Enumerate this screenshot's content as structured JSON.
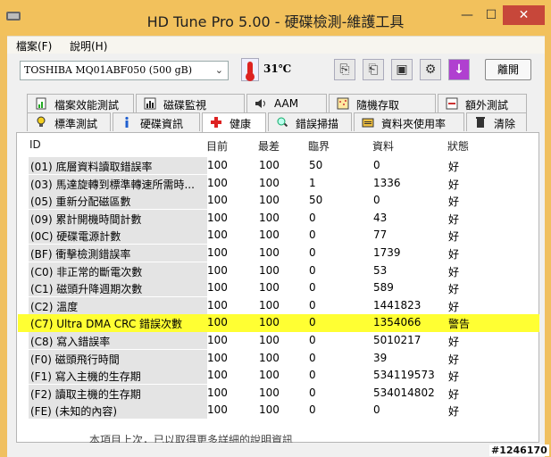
{
  "window": {
    "title": "HD Tune Pro  5.00 - 硬碟檢測-維護工具",
    "minimize": "—",
    "maximize": "☐",
    "close": "✕"
  },
  "menu": {
    "file": "檔案(F)",
    "help": "說明(H)"
  },
  "toolbar": {
    "drive": "TOSHIBA MQ01ABF050 (500 gB)",
    "temperature": "31℃",
    "exit_label": "離開"
  },
  "tabs_top": [
    {
      "label": "檔案效能測試",
      "icon": "file-benchmark-icon"
    },
    {
      "label": "磁碟監視",
      "icon": "disk-monitor-icon"
    },
    {
      "label": "AAM",
      "icon": "speaker-icon"
    },
    {
      "label": "隨機存取",
      "icon": "random-access-icon"
    },
    {
      "label": "額外測試",
      "icon": "extra-tests-icon"
    }
  ],
  "tabs_bottom": [
    {
      "label": "標準測試",
      "icon": "lightbulb-icon"
    },
    {
      "label": "硬碟資訊",
      "icon": "info-icon"
    },
    {
      "label": "健康",
      "icon": "health-cross-icon"
    },
    {
      "label": "錯誤掃描",
      "icon": "magnifier-icon"
    },
    {
      "label": "資料夾使用率",
      "icon": "folder-usage-icon"
    },
    {
      "label": "清除",
      "icon": "trash-icon"
    }
  ],
  "table": {
    "headers": [
      "ID",
      "目前",
      "最差",
      "臨界",
      "資料",
      "狀態"
    ],
    "rows": [
      {
        "id": "(01) 底層資料讀取錯誤率",
        "cur": "100",
        "worst": "100",
        "thr": "50",
        "data": "0",
        "status": "好"
      },
      {
        "id": "(03) 馬達旋轉到標準轉速所需時...",
        "cur": "100",
        "worst": "100",
        "thr": "1",
        "data": "1336",
        "status": "好"
      },
      {
        "id": "(05) 重新分配磁區數",
        "cur": "100",
        "worst": "100",
        "thr": "50",
        "data": "0",
        "status": "好"
      },
      {
        "id": "(09) 累計開機時間計數",
        "cur": "100",
        "worst": "100",
        "thr": "0",
        "data": "43",
        "status": "好"
      },
      {
        "id": "(0C) 硬碟電源計數",
        "cur": "100",
        "worst": "100",
        "thr": "0",
        "data": "77",
        "status": "好"
      },
      {
        "id": "(BF) 衝擊檢測錯誤率",
        "cur": "100",
        "worst": "100",
        "thr": "0",
        "data": "1739",
        "status": "好"
      },
      {
        "id": "(C0) 非正常的斷電次數",
        "cur": "100",
        "worst": "100",
        "thr": "0",
        "data": "53",
        "status": "好"
      },
      {
        "id": "(C1) 磁頭升降週期次數",
        "cur": "100",
        "worst": "100",
        "thr": "0",
        "data": "589",
        "status": "好"
      },
      {
        "id": "(C2) 溫度",
        "cur": "100",
        "worst": "100",
        "thr": "0",
        "data": "1441823",
        "status": "好"
      },
      {
        "id": "(C7) Ultra DMA CRC 錯誤次數",
        "cur": "100",
        "worst": "100",
        "thr": "0",
        "data": "1354066",
        "status": "警告"
      },
      {
        "id": "(C8) 寫入錯誤率",
        "cur": "100",
        "worst": "100",
        "thr": "0",
        "data": "5010217",
        "status": "好"
      },
      {
        "id": "(F0) 磁頭飛行時間",
        "cur": "100",
        "worst": "100",
        "thr": "0",
        "data": "39",
        "status": "好"
      },
      {
        "id": "(F1) 寫入主機的生存期",
        "cur": "100",
        "worst": "100",
        "thr": "0",
        "data": "534119573",
        "status": "好"
      },
      {
        "id": "(F2) 讀取主機的生存期",
        "cur": "100",
        "worst": "100",
        "thr": "0",
        "data": "534014802",
        "status": "好"
      },
      {
        "id": "(FE) (未知的內容)",
        "cur": "100",
        "worst": "100",
        "thr": "0",
        "data": "0",
        "status": "好"
      }
    ]
  },
  "footer_text": "本項目上次，已以取得更多詳細的說明資訊",
  "watermark": "#1246170",
  "colors": {
    "titlebar": "#f2c15c",
    "close": "#c7473a",
    "warning_row": "#ffff33"
  }
}
